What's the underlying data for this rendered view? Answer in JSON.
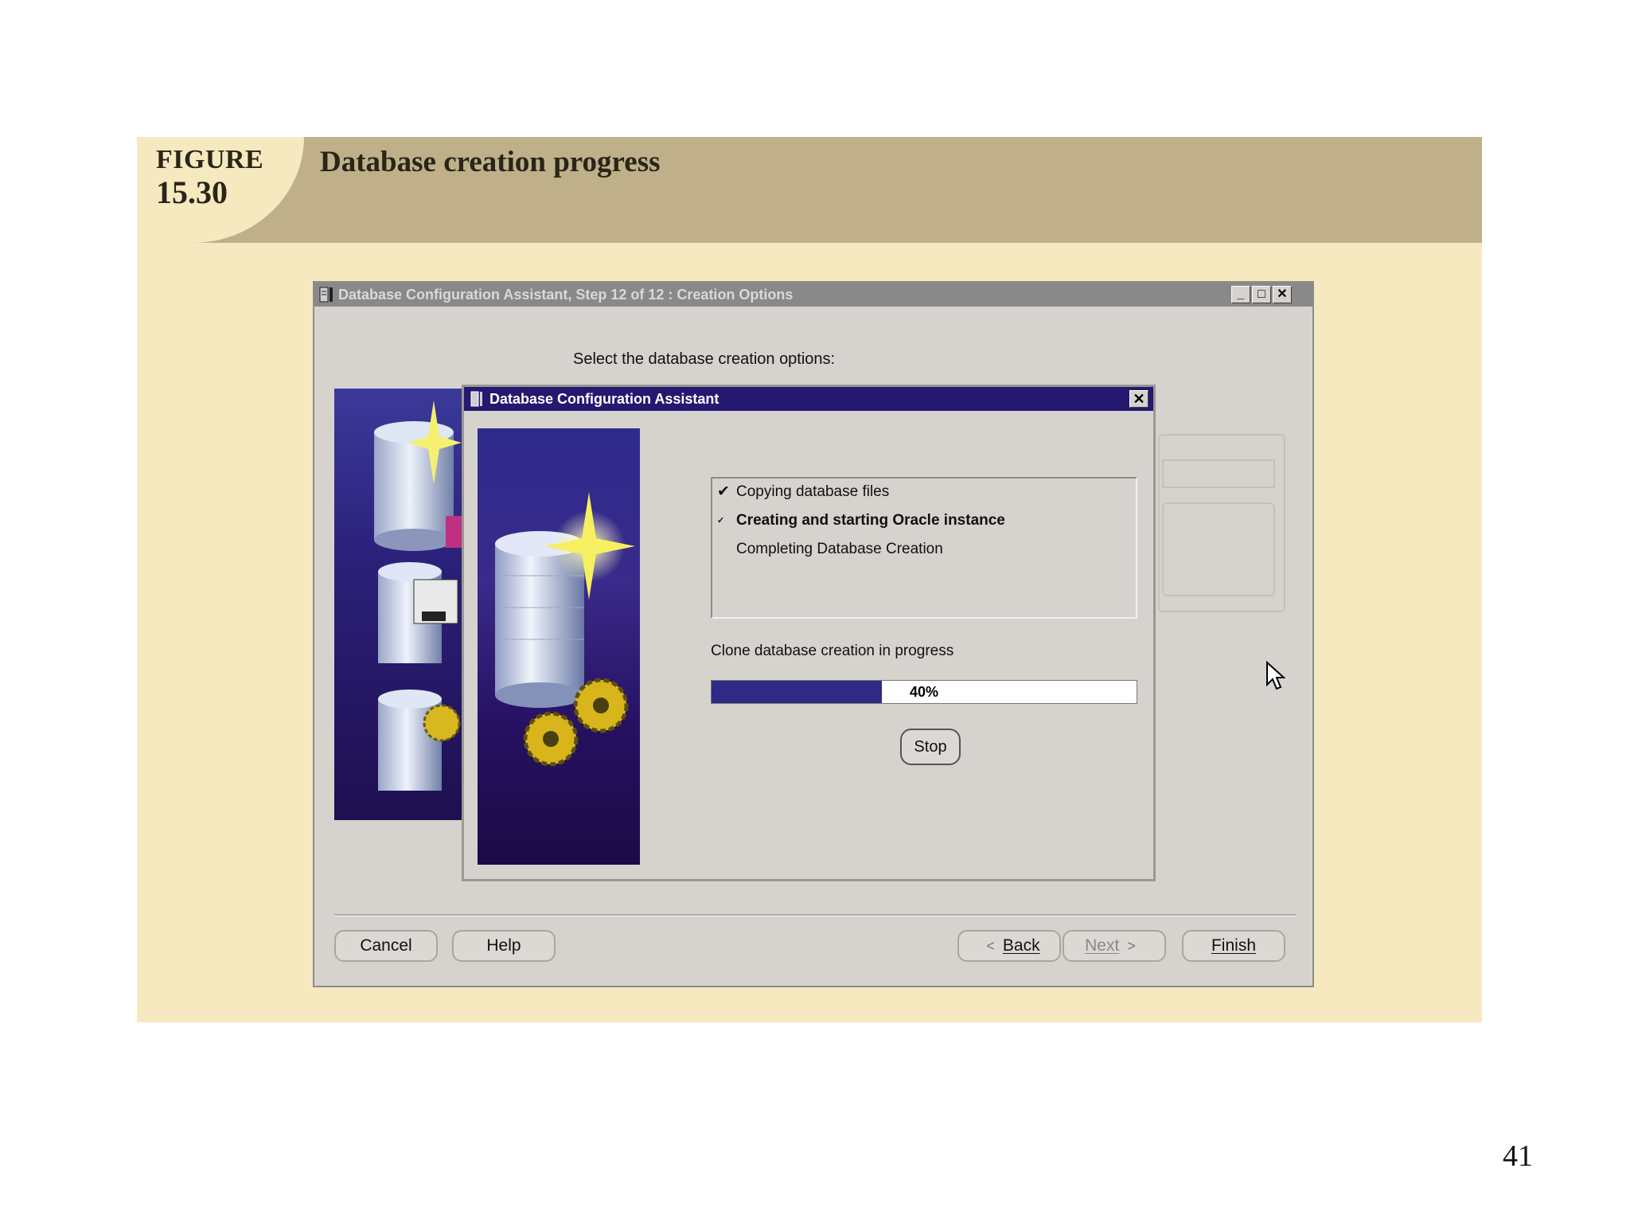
{
  "figure": {
    "label_word": "FIGURE",
    "label_number": "15.30",
    "title": "Database creation progress"
  },
  "main_window": {
    "title": "Database Configuration Assistant, Step 12 of 12 : Creation Options",
    "controls": {
      "minimize": "_",
      "maximize": "□",
      "close": "✕"
    },
    "prompt": "Select the database creation options:",
    "buttons": {
      "cancel": "Cancel",
      "help": "Help",
      "back": "Back",
      "next": "Next",
      "finish": "Finish"
    }
  },
  "dialog": {
    "title": "Database Configuration Assistant",
    "close": "✕",
    "steps": [
      {
        "mark": "✔",
        "label": "Copying database files",
        "state": "done"
      },
      {
        "mark": "✓",
        "label": "Creating and starting Oracle instance",
        "state": "current"
      },
      {
        "mark": "",
        "label": "Completing Database Creation",
        "state": "pending"
      }
    ],
    "progress_label": "Clone database creation in progress",
    "progress_percent": 40,
    "progress_text": "40%",
    "stop_label": "Stop"
  },
  "colors": {
    "header_band": "#bfb089",
    "figure_background": "#f7e9bf",
    "dialog_titlebar": "#241870",
    "progress_fill": "#2e2a86"
  },
  "icons": [
    "window-app-icon",
    "minimize-icon",
    "maximize-icon",
    "close-icon",
    "back-arrow-icon",
    "next-arrow-icon",
    "mouse-cursor-icon"
  ],
  "page_number": "41"
}
